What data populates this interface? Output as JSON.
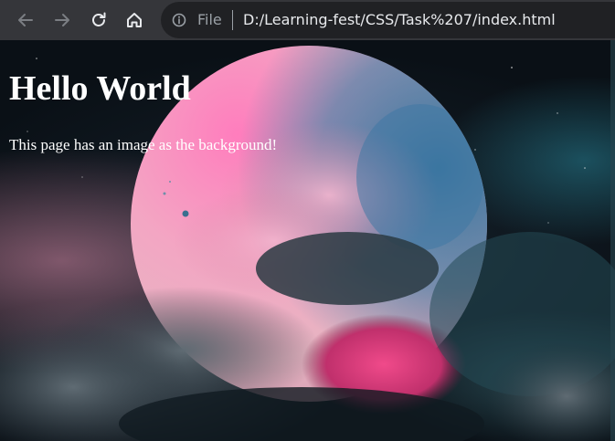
{
  "browser": {
    "toolbar": {
      "back_icon": "arrow-left-icon",
      "forward_icon": "arrow-right-icon",
      "reload_icon": "reload-icon",
      "home_icon": "home-icon"
    },
    "address_bar": {
      "info_icon": "info-icon",
      "scheme": "File",
      "url": "D:/Learning-fest/CSS/Task%207/index.html"
    }
  },
  "page": {
    "heading": "Hello World",
    "paragraph": "This page has an image as the background!"
  },
  "colors": {
    "toolbar_bg": "#35363a",
    "omnibox_bg": "#202124",
    "url_text": "#e8eaed",
    "muted_text": "#9aa0a6",
    "page_text": "#ffffff"
  }
}
